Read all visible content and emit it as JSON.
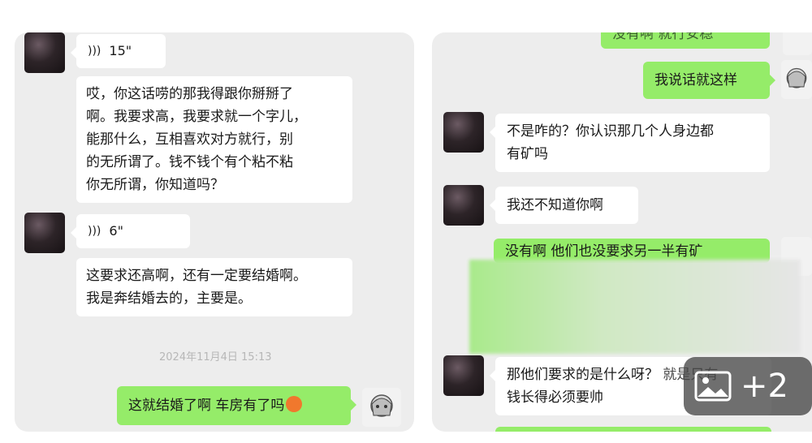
{
  "left": {
    "voice1": {
      "duration": "15\""
    },
    "msg1": [
      "哎，你这话唠的那我得跟你掰掰了",
      "啊。我要求高，我要求就一个字儿，",
      "能那什么，互相喜欢对方就行，别",
      "的无所谓了。钱不钱个有个粘不粘",
      "你无所谓，你知道吗？"
    ],
    "voice2": {
      "duration": "6\""
    },
    "msg2": [
      "这要求还高啊，还有一定要结婚啊。",
      "我是奔结婚去的，主要是。"
    ],
    "timestamp": "2024年11月4日 15:13",
    "sent1": "这就结婚了啊 车房有了吗"
  },
  "right": {
    "top_cut": "没有啊 就行安稳",
    "sent1": "我说话就这样",
    "recv1": [
      "不是咋的？你认识那几个人身边都",
      "有矿吗"
    ],
    "recv2": "我还不知道你啊",
    "sent2_partial": "没有啊 他们也没要求另一半有矿",
    "recv3_line1": "那他们要求的是什么呀？",
    "recv3_cut": "就是只有",
    "recv3_line2": "钱长得必须要帅"
  },
  "badge": {
    "count": "+2"
  }
}
